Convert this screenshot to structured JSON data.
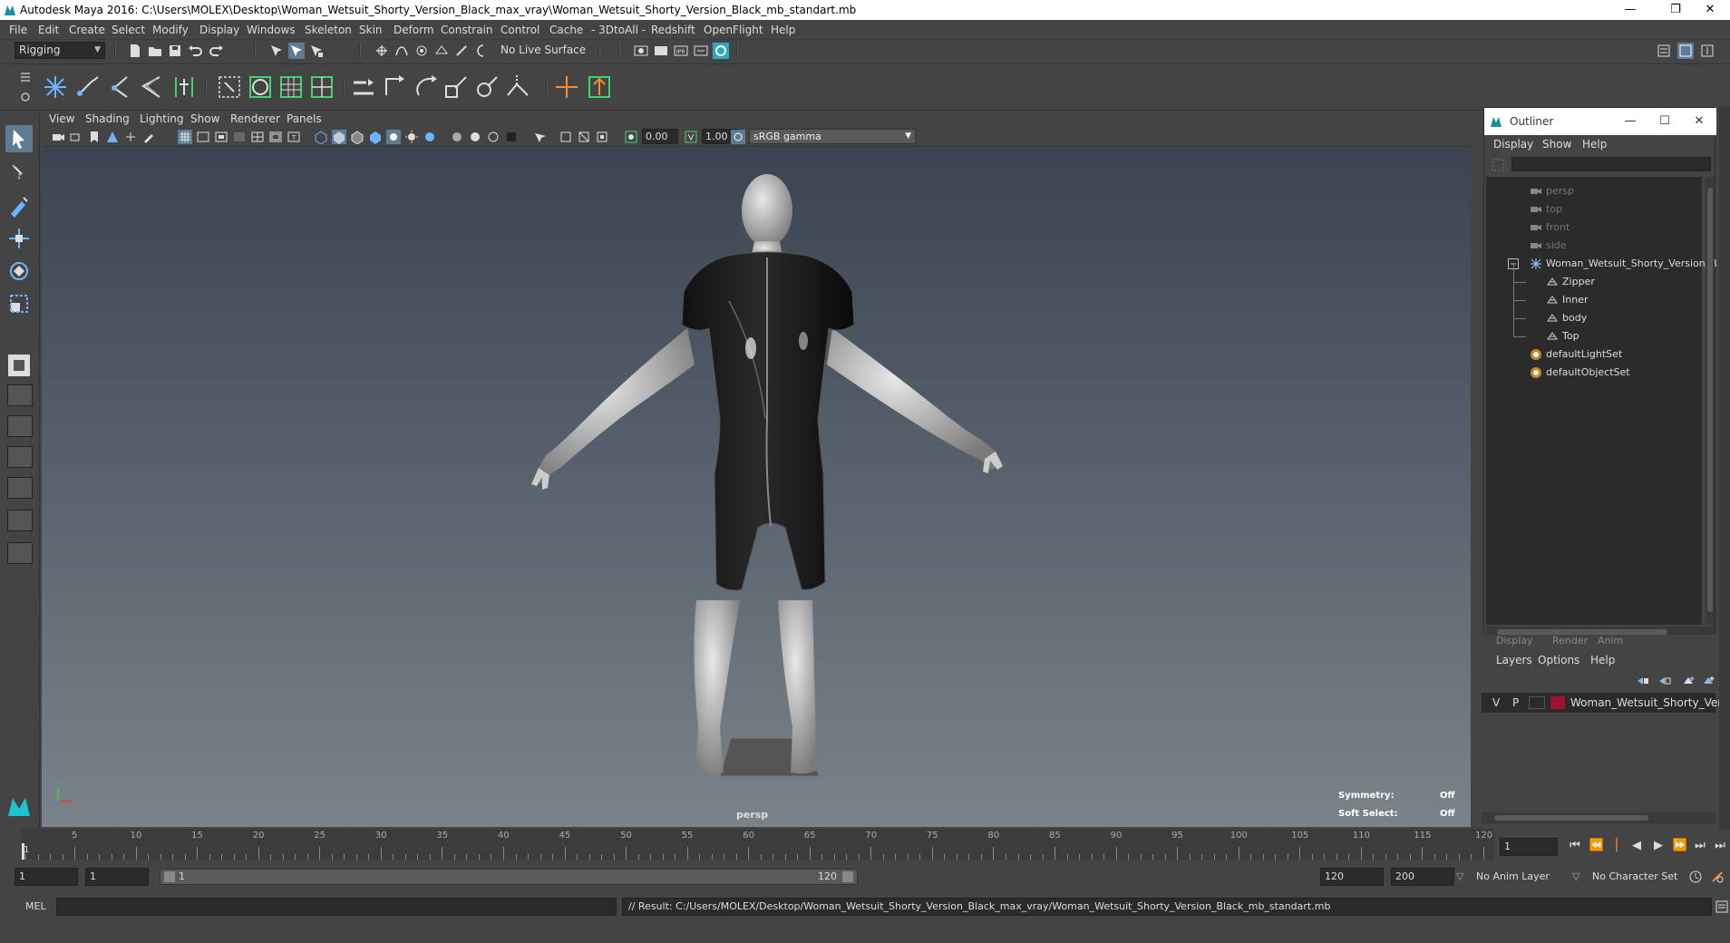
{
  "window": {
    "title": "Autodesk Maya 2016: C:\\Users\\MOLEX\\Desktop\\Woman_Wetsuit_Shorty_Version_Black_max_vray\\Woman_Wetsuit_Shorty_Version_Black_mb_standart.mb",
    "minimize": "—",
    "restore": "❐",
    "close": "✕"
  },
  "menubar": [
    "File",
    "Edit",
    "Create",
    "Select",
    "Modify",
    "Display",
    "Windows",
    "Skeleton",
    "Skin",
    "Deform",
    "Constrain",
    "Control",
    "Cache",
    "- 3DtoAll -",
    "Redshift",
    "OpenFlight",
    "Help"
  ],
  "statusline": {
    "mode": "Rigging",
    "live_surface": "No Live Surface"
  },
  "panel_menu": [
    "View",
    "Shading",
    "Lighting",
    "Show",
    "Renderer",
    "Panels"
  ],
  "panel_toolbar": {
    "exposure": "0.00",
    "gamma": "1.00",
    "color_space": "sRGB gamma"
  },
  "viewport": {
    "camera_label": "persp",
    "hud": {
      "symmetry_label": "Symmetry:",
      "symmetry_value": "Off",
      "soft_select_label": "Soft Select:",
      "soft_select_value": "Off"
    },
    "axis": {
      "x": "x",
      "y": "y",
      "z": "z"
    }
  },
  "outliner": {
    "title": "Outliner",
    "menu": [
      "Display",
      "Show",
      "Help"
    ],
    "items": [
      {
        "label": "persp",
        "icon": "camera-icon",
        "dim": true
      },
      {
        "label": "top",
        "icon": "camera-icon",
        "dim": true
      },
      {
        "label": "front",
        "icon": "camera-icon",
        "dim": true
      },
      {
        "label": "side",
        "icon": "camera-icon",
        "dim": true
      },
      {
        "label": "Woman_Wetsuit_Shorty_Version_B",
        "icon": "group-icon",
        "dim": false
      },
      {
        "label": "Zipper",
        "icon": "mesh-icon",
        "dim": false
      },
      {
        "label": "Inner",
        "icon": "mesh-icon",
        "dim": false
      },
      {
        "label": "body",
        "icon": "mesh-icon",
        "dim": false
      },
      {
        "label": "Top",
        "icon": "mesh-icon",
        "dim": false
      },
      {
        "label": "defaultLightSet",
        "icon": "set-icon",
        "dim": false
      },
      {
        "label": "defaultObjectSet",
        "icon": "set-icon",
        "dim": false
      }
    ]
  },
  "layer_editor": {
    "tabs": [
      "Display",
      "Render",
      "Anim"
    ],
    "menu": [
      "Layers",
      "Options",
      "Help"
    ],
    "layer": {
      "visible": "V",
      "playback": "P",
      "name": "Woman_Wetsuit_Shorty_Version",
      "color": "#a01030"
    }
  },
  "timeline": {
    "ticks": [
      "5",
      "10",
      "15",
      "20",
      "25",
      "30",
      "35",
      "40",
      "45",
      "50",
      "55",
      "60",
      "65",
      "70",
      "75",
      "80",
      "85",
      "90",
      "95",
      "100",
      "105",
      "110",
      "115",
      "120"
    ],
    "current_frame_marker": "1",
    "current_frame": "1"
  },
  "range": {
    "start": "1",
    "playback_start": "1",
    "slider_start": "1",
    "slider_end": "120",
    "playback_end": "120",
    "end": "200",
    "anim_layer": "No Anim Layer",
    "character_set": "No Character Set"
  },
  "command_line": {
    "language": "MEL",
    "result": "// Result: C:/Users/MOLEX/Desktop/Woman_Wetsuit_Shorty_Version_Black_max_vray/Woman_Wetsuit_Shorty_Version_Black_mb_standart.mb"
  },
  "colors": {
    "accent": "#5d7b93",
    "viewport_top": "#3b4450",
    "viewport_bottom": "#7a8389",
    "layer_color": "#a01030"
  }
}
